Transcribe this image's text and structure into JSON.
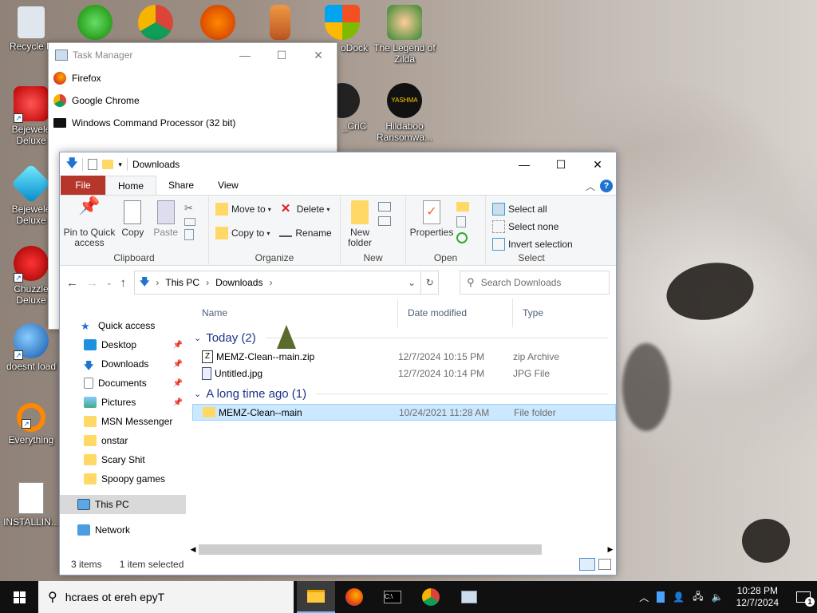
{
  "desktop": {
    "icons": [
      {
        "label": "Recycle B"
      },
      {
        "label": "Bejewele Deluxe"
      },
      {
        "label": "Bejewele Deluxe"
      },
      {
        "label": "Chuzzle Deluxe"
      },
      {
        "label": "doesnt load"
      },
      {
        "label": "Everything"
      },
      {
        "label": "INSTALLIN..."
      },
      {
        "label": "oDock"
      },
      {
        "label": "The Legend of Zilda"
      },
      {
        "label": "_CriC"
      },
      {
        "label": "Hildaboo Ransomwa..."
      }
    ],
    "yashma_text": "YASHMA"
  },
  "task_manager": {
    "title": "Task Manager",
    "processes": [
      "Firefox",
      "Google Chrome",
      "Windows Command Processor (32 bit)"
    ]
  },
  "explorer": {
    "title": "Downloads",
    "tabs": [
      "File",
      "Home",
      "Share",
      "View"
    ],
    "ribbon": {
      "clipboard": {
        "pin": "Pin to Quick access",
        "copy": "Copy",
        "paste": "Paste",
        "label": "Clipboard"
      },
      "organize": {
        "move_to": "Move to",
        "copy_to": "Copy to",
        "delete": "Delete",
        "rename": "Rename",
        "label": "Organize"
      },
      "new": {
        "new_folder": "New folder",
        "label": "New"
      },
      "open": {
        "properties": "Properties",
        "label": "Open"
      },
      "select": {
        "select_all": "Select all",
        "select_none": "Select none",
        "invert": "Invert selection",
        "label": "Select"
      }
    },
    "address": {
      "path": [
        "This PC",
        "Downloads"
      ],
      "search_placeholder": "Search Downloads"
    },
    "nav": {
      "quick_access": "Quick access",
      "items": [
        {
          "label": "Desktop",
          "pinned": true
        },
        {
          "label": "Downloads",
          "pinned": true
        },
        {
          "label": "Documents",
          "pinned": true
        },
        {
          "label": "Pictures",
          "pinned": true
        },
        {
          "label": "MSN Messenger",
          "pinned": false
        },
        {
          "label": "onstar",
          "pinned": false
        },
        {
          "label": "Scary Shit",
          "pinned": false
        },
        {
          "label": "Spoopy games",
          "pinned": false
        }
      ],
      "this_pc": "This PC",
      "network": "Network"
    },
    "columns": [
      "Name",
      "Date modified",
      "Type"
    ],
    "groups": [
      {
        "label": "Today (2)",
        "files": [
          {
            "name": "MEMZ-Clean--main.zip",
            "date": "12/7/2024 10:15 PM",
            "type": "zip Archive",
            "icon": "zip-icon"
          },
          {
            "name": "Untitled.jpg",
            "date": "12/7/2024 10:14 PM",
            "type": "JPG File",
            "icon": "image-file-icon"
          }
        ]
      },
      {
        "label": "A long time ago (1)",
        "files": [
          {
            "name": "MEMZ-Clean--main",
            "date": "10/24/2021 11:28 AM",
            "type": "File folder",
            "icon": "folder-icon",
            "selected": true
          }
        ]
      }
    ],
    "status": {
      "count": "3 items",
      "selected": "1 item selected"
    }
  },
  "taskbar": {
    "search_text": "hcraes ot ereh epyT",
    "time": "10:28 PM",
    "date": "12/7/2024",
    "notification_count": "1"
  }
}
